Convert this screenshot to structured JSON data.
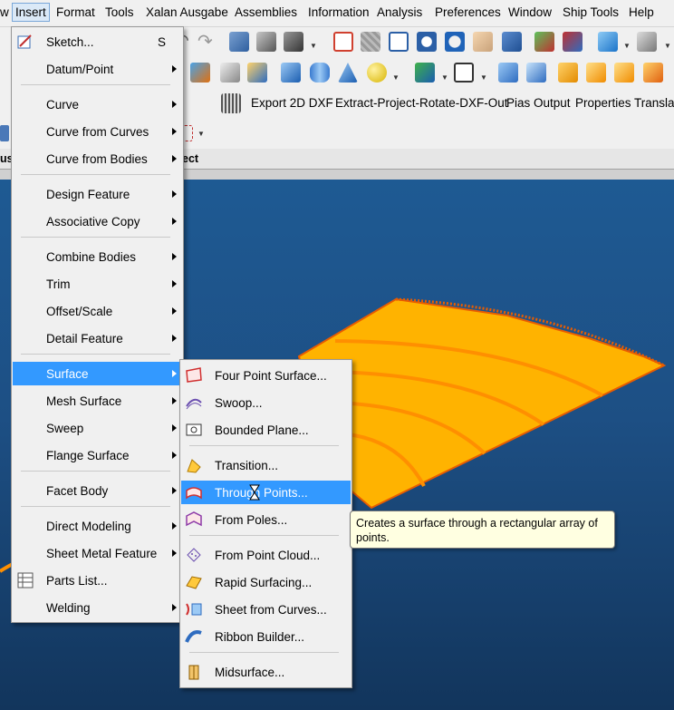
{
  "menubar": {
    "items": [
      "w",
      "Insert",
      "Format",
      "Tools",
      "Xalan Ausgabe",
      "Assemblies",
      "Information",
      "Analysis",
      "Preferences",
      "Window",
      "Ship Tools",
      "Help"
    ]
  },
  "toolbar3": {
    "items": [
      "Export 2D DXF",
      "Extract-Project-Rotate-DXF-Out",
      "Pias Output",
      "Properties",
      "Translat"
    ]
  },
  "toolbar5": {
    "left_text": "us",
    "right_text": "ect"
  },
  "insert_menu": {
    "items": [
      {
        "label": "Sketch...",
        "shortcut": "S",
        "has_icon": true
      },
      {
        "label": "Datum/Point",
        "submenu": true
      },
      {
        "label": "Curve",
        "submenu": true
      },
      {
        "label": "Curve from Curves",
        "submenu": true
      },
      {
        "label": "Curve from Bodies",
        "submenu": true
      },
      {
        "label": "Design Feature",
        "submenu": true
      },
      {
        "label": "Associative Copy",
        "submenu": true
      },
      {
        "label": "Combine Bodies",
        "submenu": true
      },
      {
        "label": "Trim",
        "submenu": true
      },
      {
        "label": "Offset/Scale",
        "submenu": true
      },
      {
        "label": "Detail Feature",
        "submenu": true
      },
      {
        "label": "Surface",
        "submenu": true,
        "highlighted": true
      },
      {
        "label": "Mesh Surface",
        "submenu": true
      },
      {
        "label": "Sweep",
        "submenu": true
      },
      {
        "label": "Flange Surface",
        "submenu": true
      },
      {
        "label": "Facet Body",
        "submenu": true
      },
      {
        "label": "Direct Modeling",
        "submenu": true
      },
      {
        "label": "Sheet Metal Feature",
        "submenu": true
      },
      {
        "label": "Parts List...",
        "has_icon": true
      },
      {
        "label": "Welding",
        "submenu": true
      }
    ]
  },
  "surface_menu": {
    "items": [
      {
        "label": "Four Point Surface...",
        "icon": "four-point-surface-icon"
      },
      {
        "label": "Swoop...",
        "icon": "swoop-icon"
      },
      {
        "label": "Bounded Plane...",
        "icon": "bounded-plane-icon"
      },
      {
        "label": "Transition...",
        "icon": "transition-icon"
      },
      {
        "label": "Through Points...",
        "icon": "through-points-icon",
        "highlighted": true
      },
      {
        "label": "From Poles...",
        "icon": "from-poles-icon"
      },
      {
        "label": "From Point Cloud...",
        "icon": "point-cloud-icon"
      },
      {
        "label": "Rapid Surfacing...",
        "icon": "rapid-surfacing-icon"
      },
      {
        "label": "Sheet from Curves...",
        "icon": "sheet-from-curves-icon"
      },
      {
        "label": "Ribbon Builder...",
        "icon": "ribbon-builder-icon"
      },
      {
        "label": "Midsurface...",
        "icon": "midsurface-icon"
      }
    ]
  },
  "tooltip": {
    "text": "Creates a surface through a rectangular array of points."
  },
  "colors": {
    "highlight": "#3399ff",
    "surface": "#ffb300",
    "viewport": "#1d4f84",
    "tooltip_bg": "#ffffe1"
  }
}
